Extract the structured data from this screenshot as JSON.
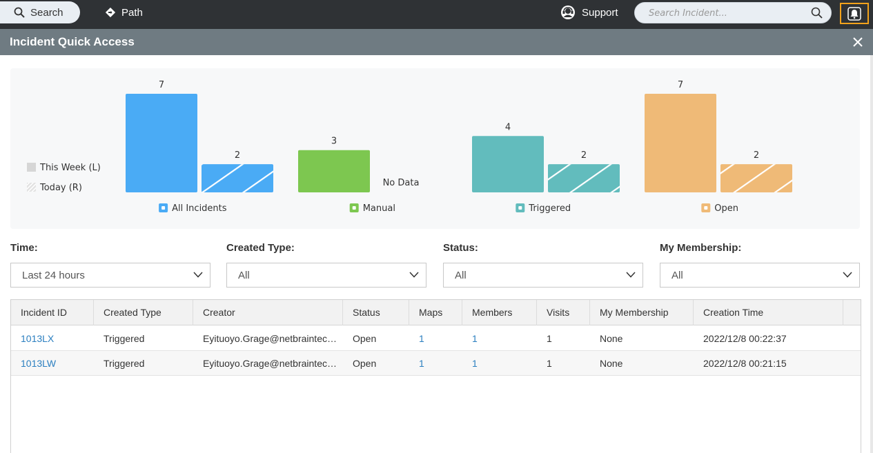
{
  "topbar": {
    "search_tab": "Search",
    "path_tab": "Path",
    "support": "Support",
    "search_placeholder": "Search Incident..."
  },
  "panel": {
    "title": "Incident Quick Access"
  },
  "chart_data": {
    "type": "bar",
    "categories": [
      "All Incidents",
      "Manual",
      "Triggered",
      "Open"
    ],
    "series": [
      {
        "name": "This Week (L)",
        "values": [
          7,
          3,
          4,
          7
        ]
      },
      {
        "name": "Today (R)",
        "values": [
          2,
          null,
          2,
          2
        ]
      }
    ],
    "no_data_label": "No Data",
    "ylim": [
      0,
      7
    ],
    "legend_position": "left",
    "colors": {
      "All Incidents": "#4aabf5",
      "Manual": "#7dc750",
      "Triggered": "#62bcbd",
      "Open": "#efba77",
      "legend_week": "#d6d6d6",
      "legend_today": "#e2e2e2"
    }
  },
  "filters": [
    {
      "label": "Time:",
      "value": "Last 24 hours"
    },
    {
      "label": "Created Type:",
      "value": "All"
    },
    {
      "label": "Status:",
      "value": "All"
    },
    {
      "label": "My Membership:",
      "value": "All"
    }
  ],
  "table": {
    "columns": [
      "Incident ID",
      "Created Type",
      "Creator",
      "Status",
      "Maps",
      "Members",
      "Visits",
      "My Membership",
      "Creation Time"
    ],
    "rows": [
      [
        "1013LX",
        "Triggered",
        "Eyituoyo.Grage@netbraintech.com",
        "Open",
        "1",
        "1",
        "1",
        "None",
        "2022/12/8 00:22:37"
      ],
      [
        "1013LW",
        "Triggered",
        "Eyituoyo.Grage@netbraintech.com",
        "Open",
        "1",
        "1",
        "1",
        "None",
        "2022/12/8 00:21:15"
      ]
    ]
  }
}
